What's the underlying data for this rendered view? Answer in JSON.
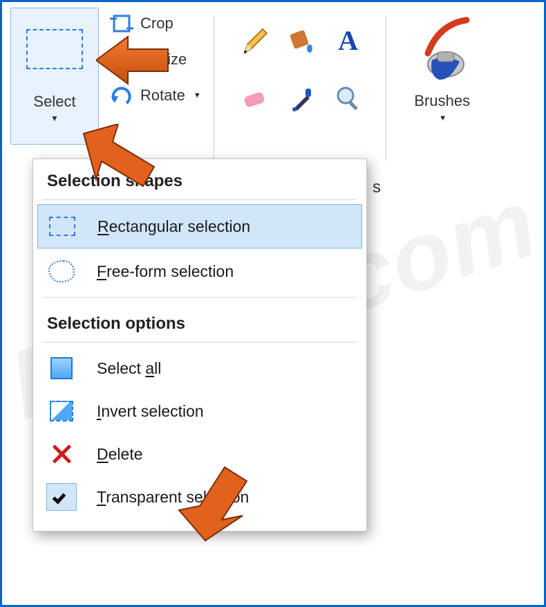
{
  "ribbon": {
    "select": {
      "label": "Select"
    },
    "items": [
      {
        "label": "Crop"
      },
      {
        "label": "Resize"
      },
      {
        "label": "Rotate"
      }
    ],
    "tools": {
      "pencil": "pencil-icon",
      "fill": "fill-icon",
      "text": "text-icon",
      "eraser": "eraser-icon",
      "picker": "color-picker-icon",
      "magnifier": "magnifier-icon"
    },
    "tools_tail": "s",
    "brushes": {
      "label": "Brushes"
    }
  },
  "dropdown": {
    "shapes_header": "Selection shapes",
    "options_header": "Selection options",
    "rectangular": {
      "u": "R",
      "rest": "ectangular selection"
    },
    "freeform": {
      "u": "F",
      "rest": "ree-form selection"
    },
    "select_all": {
      "pre": "Select ",
      "u": "a",
      "rest": "ll"
    },
    "invert": {
      "u": "I",
      "rest": "nvert selection"
    },
    "delete": {
      "u": "D",
      "rest": "elete"
    },
    "transparent": {
      "u": "T",
      "rest": "ransparent selection"
    }
  },
  "watermark": "PCrisk.com"
}
